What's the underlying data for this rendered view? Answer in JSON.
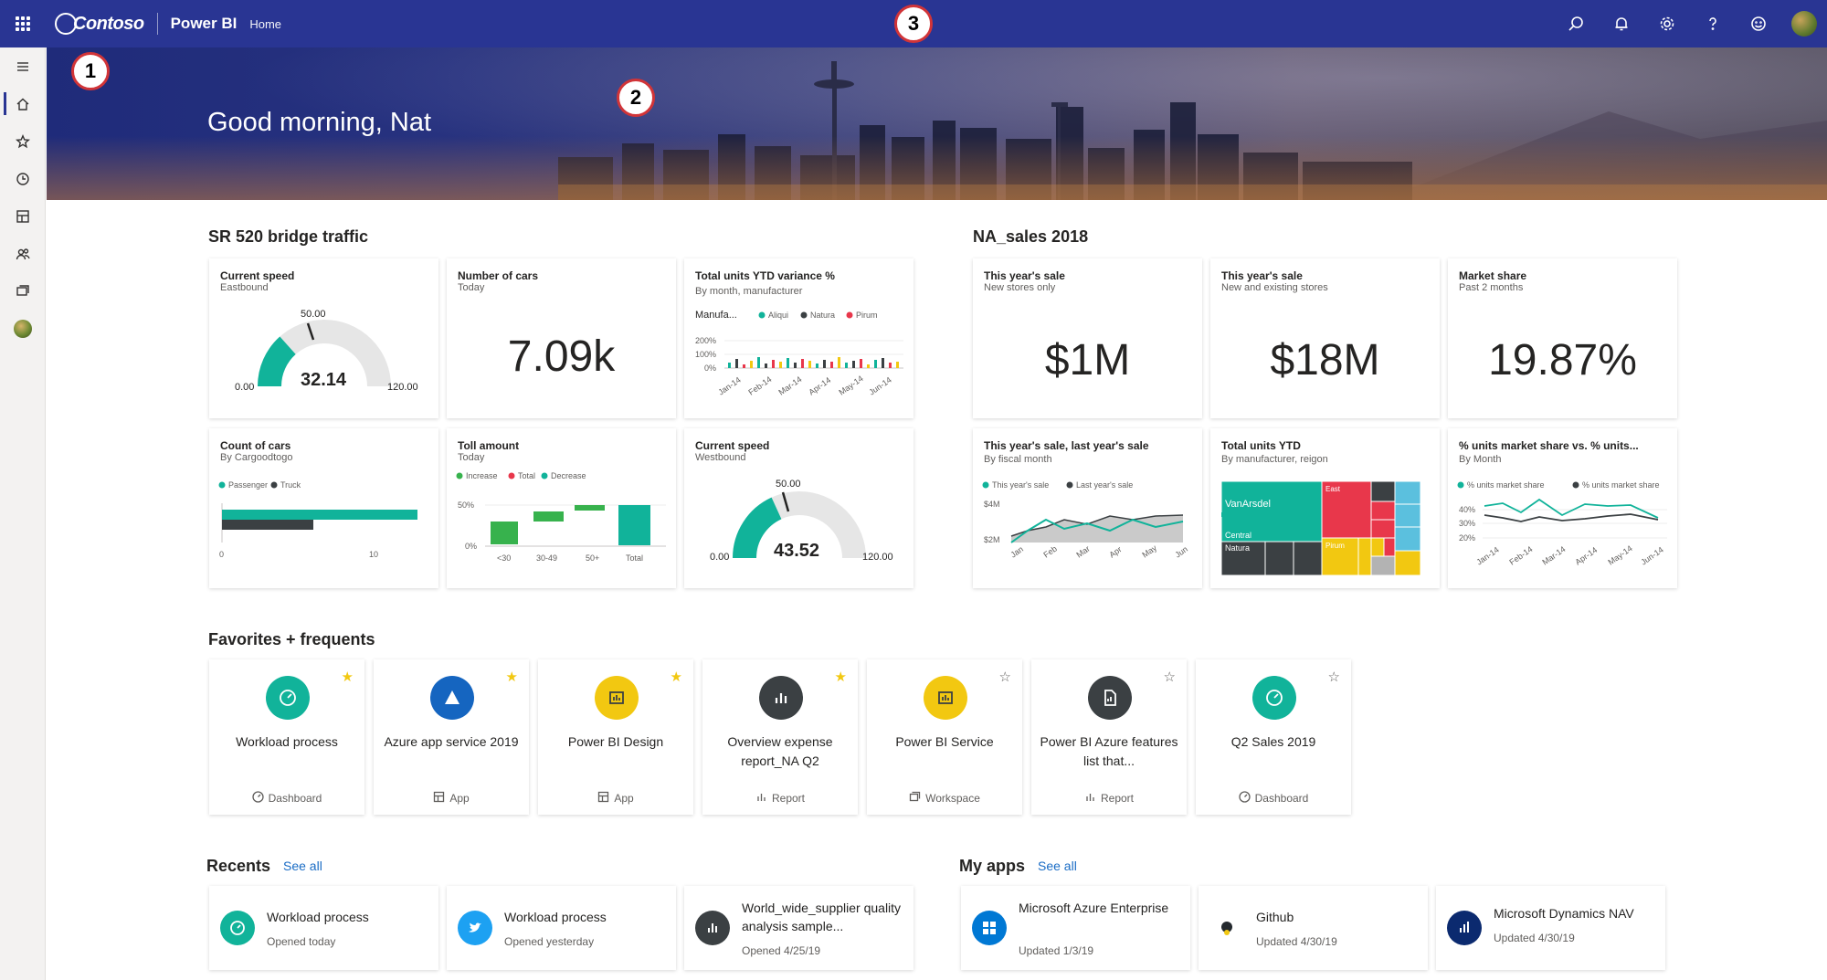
{
  "header": {
    "brand": "Contoso",
    "app": "Power BI",
    "breadcrumb": "Home",
    "icons": [
      "search-icon",
      "bell-icon",
      "gear-icon",
      "help-icon",
      "smiley-icon",
      "avatar"
    ]
  },
  "rail": {
    "icons": [
      "hamburger-icon",
      "home-icon",
      "star-icon",
      "clock-icon",
      "apps-icon",
      "shared-icon",
      "workspaces-icon",
      "avatar"
    ]
  },
  "banner": {
    "greeting": "Good morning, Nat"
  },
  "callouts": [
    "1",
    "2",
    "3"
  ],
  "dashboards": {
    "sr520": {
      "title": "SR 520 bridge traffic",
      "tiles": {
        "current_speed_east": {
          "title": "Current speed",
          "sub": "Eastbound",
          "value": "32.14",
          "min": "0.00",
          "max": "120.00",
          "target": "50.00",
          "gauge_fraction": 0.268
        },
        "number_of_cars": {
          "title": "Number of cars",
          "sub": "Today",
          "value": "7.09k"
        },
        "ytd_variance": {
          "title": "Total units YTD variance %",
          "sub": "By month, manufacturer",
          "legend_prefix": "Manufa...",
          "legend": [
            "Aliqui",
            "Natura",
            "Pirum"
          ],
          "y_ticks": [
            "200%",
            "100%",
            "0%"
          ],
          "x_ticks": [
            "Jan-14",
            "Feb-14",
            "Mar-14",
            "Apr-14",
            "May-14",
            "Jun-14"
          ]
        },
        "count_of_cars": {
          "title": "Count of cars",
          "sub": "By Cargoodtogo",
          "legend": [
            "Passenger",
            "Truck"
          ],
          "x_ticks": [
            "0",
            "10"
          ]
        },
        "toll_amount": {
          "title": "Toll amount",
          "sub": "Today",
          "legend": [
            "Increase",
            "Total",
            "Decrease"
          ],
          "y_ticks": [
            "50%",
            "0%"
          ],
          "x_ticks": [
            "<30",
            "30-49",
            "50+",
            "Total"
          ]
        },
        "current_speed_west": {
          "title": "Current speed",
          "sub": "Westbound",
          "value": "43.52",
          "min": "0.00",
          "max": "120.00",
          "target": "50.00",
          "gauge_fraction": 0.363
        }
      }
    },
    "na_sales": {
      "title": "NA_sales 2018",
      "tiles": {
        "this_year_new": {
          "title": "This year's sale",
          "sub": "New stores only",
          "value": "$1M"
        },
        "this_year_all": {
          "title": "This year's sale",
          "sub": "New and existing stores",
          "value": "$18M"
        },
        "market_share": {
          "title": "Market share",
          "sub": "Past 2 months",
          "value": "19.87%"
        },
        "sale_vs_last": {
          "title": "This year's sale, last year's sale",
          "sub": "By fiscal month",
          "legend": [
            "This year's sale",
            "Last year's sale"
          ],
          "y_ticks": [
            "$4M",
            "$2M"
          ],
          "x_ticks": [
            "Jan",
            "Feb",
            "Mar",
            "Apr",
            "May",
            "Jun"
          ]
        },
        "total_units": {
          "title": "Total units YTD",
          "sub": "By manufacturer, reigon",
          "labels": [
            "VanArsdel",
            "Central",
            "Natura",
            "East",
            "Pirum"
          ]
        },
        "units_share": {
          "title": "% units market share vs. % units...",
          "sub": "By Month",
          "legend": [
            "% units market share",
            "% units market share"
          ],
          "y_ticks": [
            "40%",
            "30%",
            "20%"
          ],
          "x_ticks": [
            "Jan-14",
            "Feb-14",
            "Mar-14",
            "Apr-14",
            "May-14",
            "Jun-14"
          ]
        }
      }
    }
  },
  "favorites": {
    "title": "Favorites + frequents",
    "items": [
      {
        "name": "Workload process",
        "type": "Dashboard",
        "starred": true,
        "color": "#11b39a"
      },
      {
        "name": "Azure app service 2019",
        "type": "App",
        "starred": true,
        "color": "#1565c0"
      },
      {
        "name": "Power BI Design",
        "type": "App",
        "starred": true,
        "color": "#f2c811"
      },
      {
        "name": "Overview expense report_NA Q2",
        "type": "Report",
        "starred": true,
        "color": "#3b4043"
      },
      {
        "name": "Power BI Service",
        "type": "Workspace",
        "starred": false,
        "color": "#f2c811"
      },
      {
        "name": "Power BI Azure features list that...",
        "type": "Report",
        "starred": false,
        "color": "#3b4043"
      },
      {
        "name": "Q2 Sales 2019",
        "type": "Dashboard",
        "starred": false,
        "color": "#11b39a"
      }
    ]
  },
  "recents": {
    "title": "Recents",
    "see_all": "See all",
    "items": [
      {
        "name": "Workload process",
        "meta": "Opened today",
        "color": "#11b39a"
      },
      {
        "name": "Workload process",
        "meta": "Opened yesterday",
        "color": "#1da1f2"
      },
      {
        "name": "World_wide_supplier quality analysis sample...",
        "meta": "Opened 4/25/19",
        "color": "#3b4043"
      }
    ]
  },
  "my_apps": {
    "title": "My apps",
    "see_all": "See all",
    "items": [
      {
        "name": "Microsoft Azure Enterprise",
        "meta": "Updated 1/3/19",
        "color": "#0078d4"
      },
      {
        "name": "Github",
        "meta": "Updated 4/30/19",
        "color": "#ffffff"
      },
      {
        "name": "Microsoft Dynamics NAV",
        "meta": "Updated 4/30/19",
        "color": "#0b2a6f"
      }
    ]
  },
  "colors": {
    "topbar": "#293593",
    "teal": "#11b39a",
    "dark": "#3b4043",
    "gold": "#f2c811",
    "red": "#e8374b",
    "green": "#37b24d"
  }
}
